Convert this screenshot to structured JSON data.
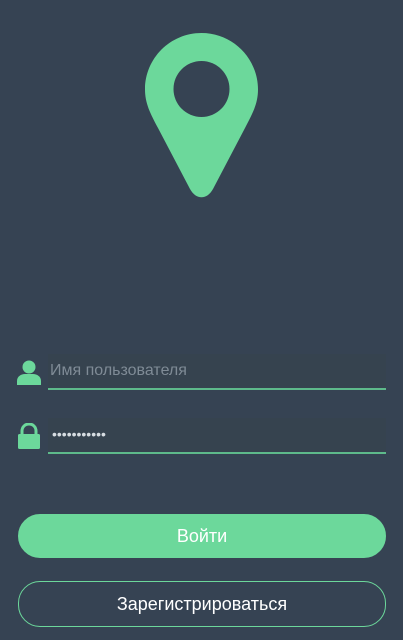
{
  "colors": {
    "background": "#364353",
    "accent": "#6cd89b",
    "underline": "#5eba8b",
    "placeholder": "#7f8b96",
    "button_text": "#ffffff"
  },
  "logo": {
    "icon": "map-pin-icon"
  },
  "login_form": {
    "username": {
      "icon": "user-icon",
      "value": "",
      "placeholder": "Имя пользователя"
    },
    "password": {
      "icon": "lock-icon",
      "masked_value": "•••••••••••"
    },
    "login_button_label": "Войти",
    "register_button_label": "Зарегистрироваться"
  }
}
